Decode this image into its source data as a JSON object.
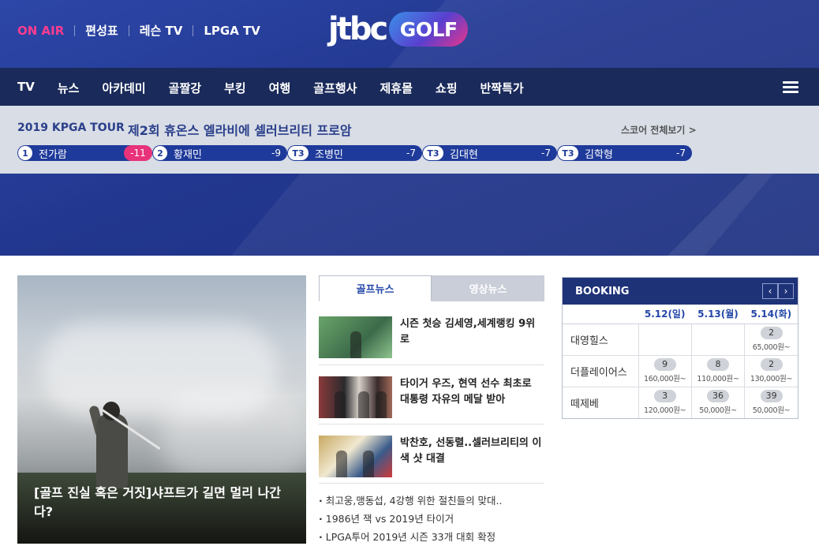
{
  "header": {
    "top_links": [
      "ON AIR",
      "편성표",
      "레슨 TV",
      "LPGA TV"
    ],
    "logo": {
      "left": "jtbc",
      "right": "GOLF"
    },
    "accent": "#ff3c8e"
  },
  "nav": {
    "items": [
      "TV",
      "뉴스",
      "아카데미",
      "골짤강",
      "부킹",
      "여행",
      "골프행사",
      "제휴몰",
      "쇼핑",
      "반짝특가"
    ],
    "menu_icon": "hamburger-icon"
  },
  "tour": {
    "name": "2019 KPGA TOUR",
    "event": "제2회 휴온스 엘라비에 셀러브리티 프로암",
    "score_link": "스코어 전체보기 >",
    "leaders": [
      {
        "rank": "1",
        "name": "전가람",
        "score": "-11"
      },
      {
        "rank": "2",
        "name": "황재민",
        "score": "-9"
      },
      {
        "rank": "T3",
        "name": "조병민",
        "score": "-7"
      },
      {
        "rank": "T3",
        "name": "김대현",
        "score": "-7"
      },
      {
        "rank": "T3",
        "name": "김학형",
        "score": "-7"
      }
    ]
  },
  "feature": {
    "caption": "[골프 진실 혹은 거짓]샤프트가 길면 멀리 나간다?"
  },
  "news": {
    "tabs": [
      "골프뉴스",
      "영상뉴스"
    ],
    "items": [
      "시즌 첫승 김세영,세계랭킹 9위로",
      "타이거 우즈, 현역 선수 최초로 대통령 자유의 메달 받아",
      "박찬호, 선동렬..셀러브리티의 이색 샷 대결"
    ],
    "bullets": [
      "최고웅,맹동섭, 4강행 위한 절친들의 맞대..",
      "1986년 잭 vs 2019년 타이거",
      "LPGA투어 2019년 시즌 33개 대회 확정"
    ]
  },
  "booking": {
    "title": "BOOKING",
    "prev": "‹",
    "next": "›",
    "dates": [
      "5.12(일)",
      "5.13(월)",
      "5.14(화)"
    ],
    "rows": [
      {
        "course": "대영힐스",
        "cells": [
          null,
          null,
          {
            "count": "2",
            "price": "65,000원~"
          }
        ]
      },
      {
        "course": "더플레이어스",
        "cells": [
          {
            "count": "9",
            "price": "160,000원~"
          },
          {
            "count": "8",
            "price": "110,000원~"
          },
          {
            "count": "2",
            "price": "130,000원~"
          }
        ]
      },
      {
        "course": "떼제베",
        "cells": [
          {
            "count": "3",
            "price": "120,000원~"
          },
          {
            "count": "36",
            "price": "50,000원~"
          },
          {
            "count": "39",
            "price": "50,000원~"
          }
        ]
      }
    ]
  }
}
